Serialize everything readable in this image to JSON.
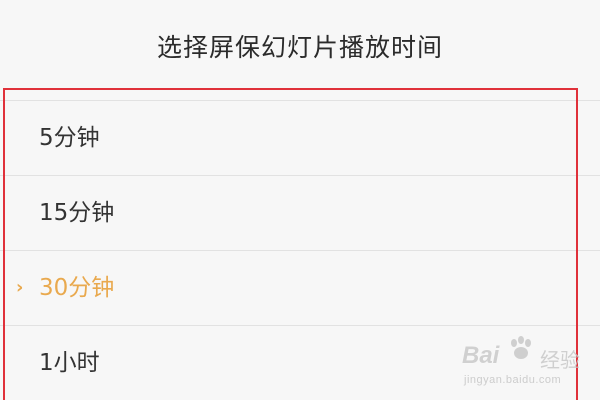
{
  "dialog": {
    "title": "选择屏保幻灯片播放时间"
  },
  "options": [
    {
      "label": "5分钟",
      "selected": false
    },
    {
      "label": "15分钟",
      "selected": false
    },
    {
      "label": "30分钟",
      "selected": true
    },
    {
      "label": "1小时",
      "selected": false
    }
  ],
  "selected_marker": "›",
  "colors": {
    "selected": "#e9a94e",
    "highlight_box": "#e0313a",
    "background": "#f7f7f7"
  },
  "watermark": {
    "main": "Bai",
    "sub": "经验",
    "url": "jingyan.baidu.com",
    "icon": "paw-icon"
  }
}
